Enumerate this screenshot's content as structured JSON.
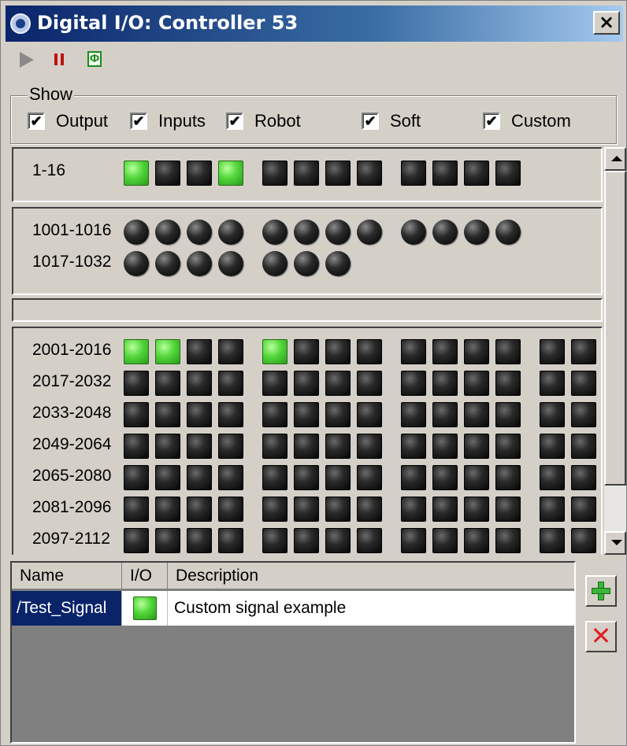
{
  "window": {
    "title": "Digital I/O: Controller 53",
    "close_label": "×"
  },
  "toolbar": {
    "play_icon": "play-icon",
    "pause_icon": "pause-icon",
    "cycle_icon": "cycle-icon",
    "cycle_glyph": "Φ"
  },
  "show": {
    "legend": "Show",
    "options": [
      {
        "label": "Output",
        "checked": true
      },
      {
        "label": "Inputs",
        "checked": true
      },
      {
        "label": "Robot",
        "checked": true
      },
      {
        "label": "Soft",
        "checked": true
      },
      {
        "label": "Custom",
        "checked": true
      }
    ]
  },
  "io": {
    "output_rows": [
      {
        "label": "1-16",
        "states": [
          1,
          0,
          0,
          1,
          0,
          0,
          0,
          0,
          0,
          0,
          0,
          0
        ]
      }
    ],
    "input_rows": [
      {
        "label": "1001-1016",
        "count": 12
      },
      {
        "label": "1017-1032",
        "count": 7
      }
    ],
    "soft_rows": [
      {
        "label": "2001-2016",
        "states": [
          1,
          1,
          0,
          0,
          1,
          0,
          0,
          0,
          0,
          0,
          0,
          0,
          0,
          0
        ]
      },
      {
        "label": "2017-2032",
        "states": [
          0,
          0,
          0,
          0,
          0,
          0,
          0,
          0,
          0,
          0,
          0,
          0,
          0,
          0
        ]
      },
      {
        "label": "2033-2048",
        "states": [
          0,
          0,
          0,
          0,
          0,
          0,
          0,
          0,
          0,
          0,
          0,
          0,
          0,
          0
        ]
      },
      {
        "label": "2049-2064",
        "states": [
          0,
          0,
          0,
          0,
          0,
          0,
          0,
          0,
          0,
          0,
          0,
          0,
          0,
          0
        ]
      },
      {
        "label": "2065-2080",
        "states": [
          0,
          0,
          0,
          0,
          0,
          0,
          0,
          0,
          0,
          0,
          0,
          0,
          0,
          0
        ]
      },
      {
        "label": "2081-2096",
        "states": [
          0,
          0,
          0,
          0,
          0,
          0,
          0,
          0,
          0,
          0,
          0,
          0,
          0,
          0
        ]
      },
      {
        "label": "2097-2112",
        "states": [
          0,
          0,
          0,
          0,
          0,
          0,
          0,
          0,
          0,
          0,
          0,
          0,
          0,
          0
        ]
      }
    ]
  },
  "signals": {
    "columns": [
      "Name",
      "I/O",
      "Description"
    ],
    "rows": [
      {
        "name": "/Test_Signal",
        "io_on": true,
        "description": "Custom signal example"
      }
    ]
  },
  "side_buttons": {
    "add_icon": "add-icon",
    "delete_icon": "delete-icon",
    "delete_glyph": "✕"
  }
}
